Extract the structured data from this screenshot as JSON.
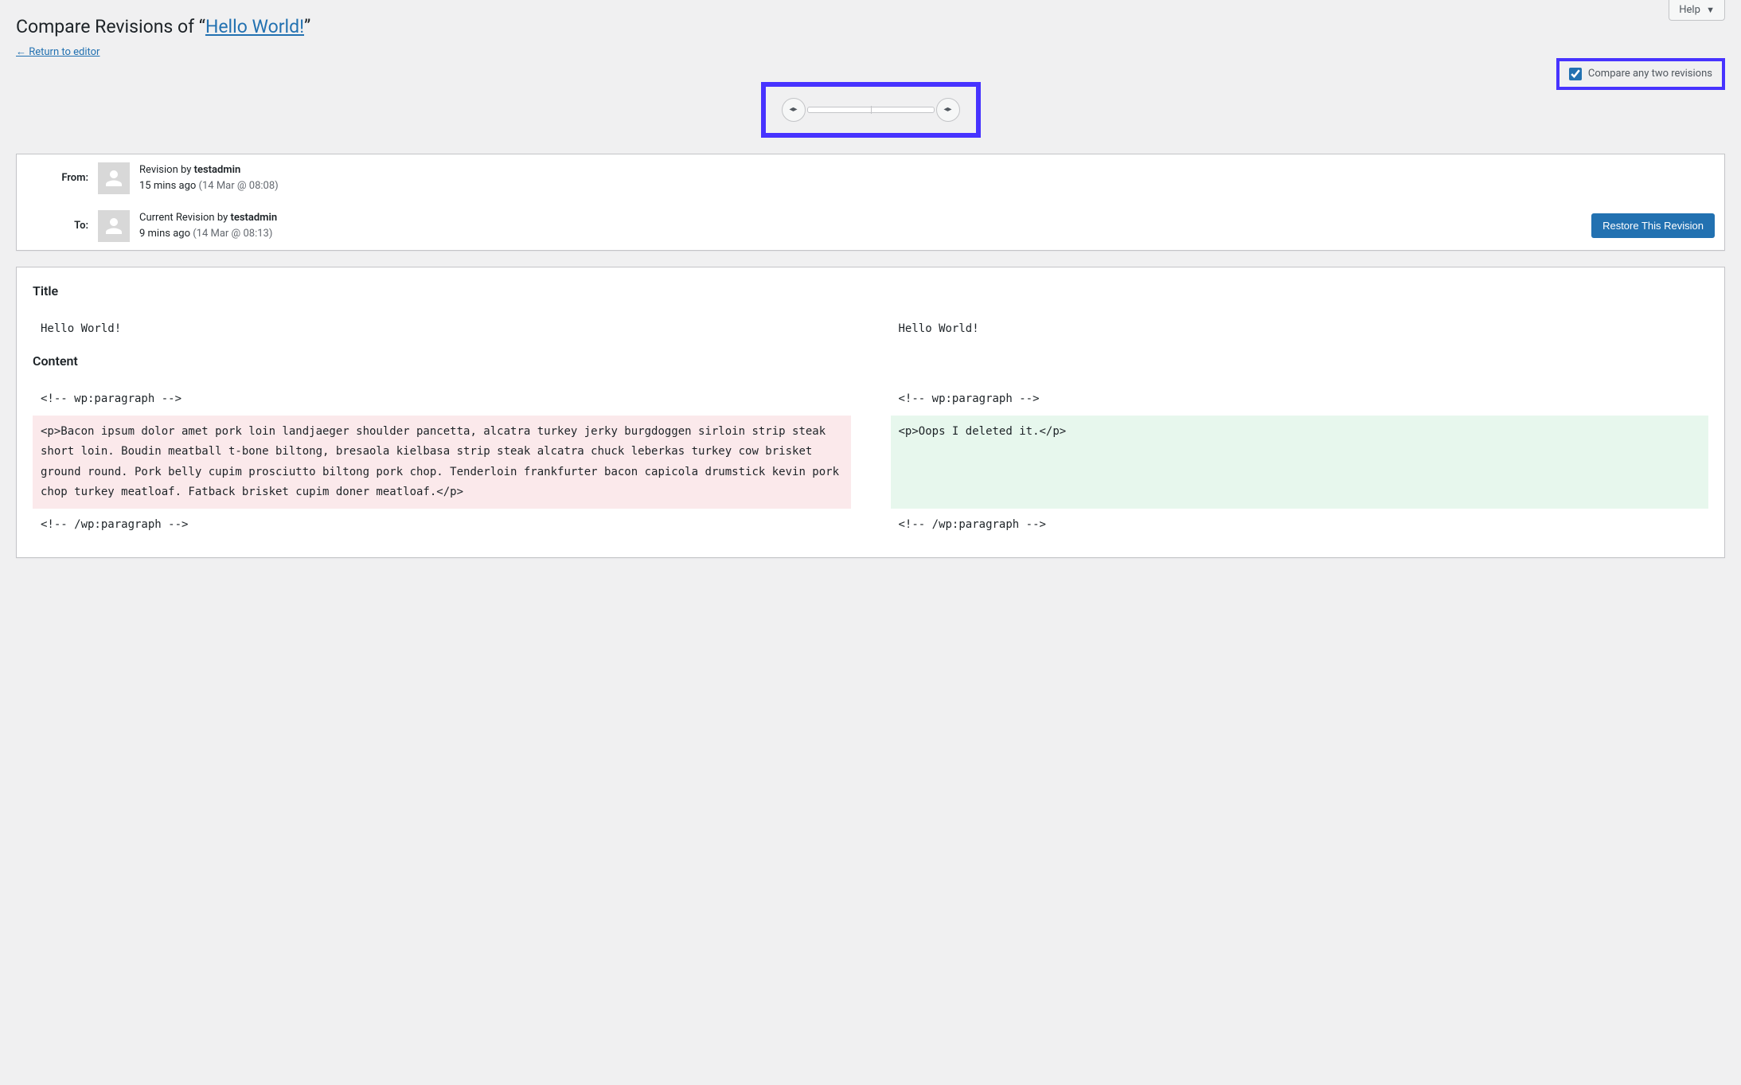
{
  "help": {
    "label": "Help"
  },
  "header": {
    "title_prefix": "Compare Revisions of “",
    "post_title": "Hello World!",
    "title_suffix": "”",
    "return_link": "← Return to editor"
  },
  "compare_toggle": {
    "label": "Compare any two revisions",
    "checked": true
  },
  "meta": {
    "from_label": "From:",
    "to_label": "To:",
    "from": {
      "prefix": "Revision by ",
      "author": "testadmin",
      "time_ago": "15 mins ago ",
      "timestamp": "(14 Mar @ 08:08)"
    },
    "to": {
      "prefix": "Current Revision by ",
      "author": "testadmin",
      "time_ago": "9 mins ago ",
      "timestamp": "(14 Mar @ 08:13)"
    },
    "restore_button": "Restore This Revision"
  },
  "diff": {
    "title_heading": "Title",
    "content_heading": "Content",
    "title_left": "Hello World!",
    "title_right": "Hello World!",
    "rows": [
      {
        "left": "<!-- wp:paragraph -->",
        "right": "<!-- wp:paragraph -->",
        "type": "context"
      },
      {
        "left": "<p>Bacon ipsum dolor amet pork loin landjaeger shoulder pancetta, alcatra turkey jerky burgdoggen sirloin strip steak short loin. Boudin meatball t-bone biltong, bresaola kielbasa strip steak alcatra chuck leberkas turkey cow brisket ground round. Pork belly cupim prosciutto biltong pork chop. Tenderloin frankfurter bacon capicola drumstick kevin pork chop turkey meatloaf. Fatback brisket cupim doner meatloaf.</p>",
        "right": "<p>Oops I deleted it.</p>",
        "type": "change"
      },
      {
        "left": "<!-- /wp:paragraph -->",
        "right": "<!-- /wp:paragraph -->",
        "type": "context"
      }
    ]
  }
}
